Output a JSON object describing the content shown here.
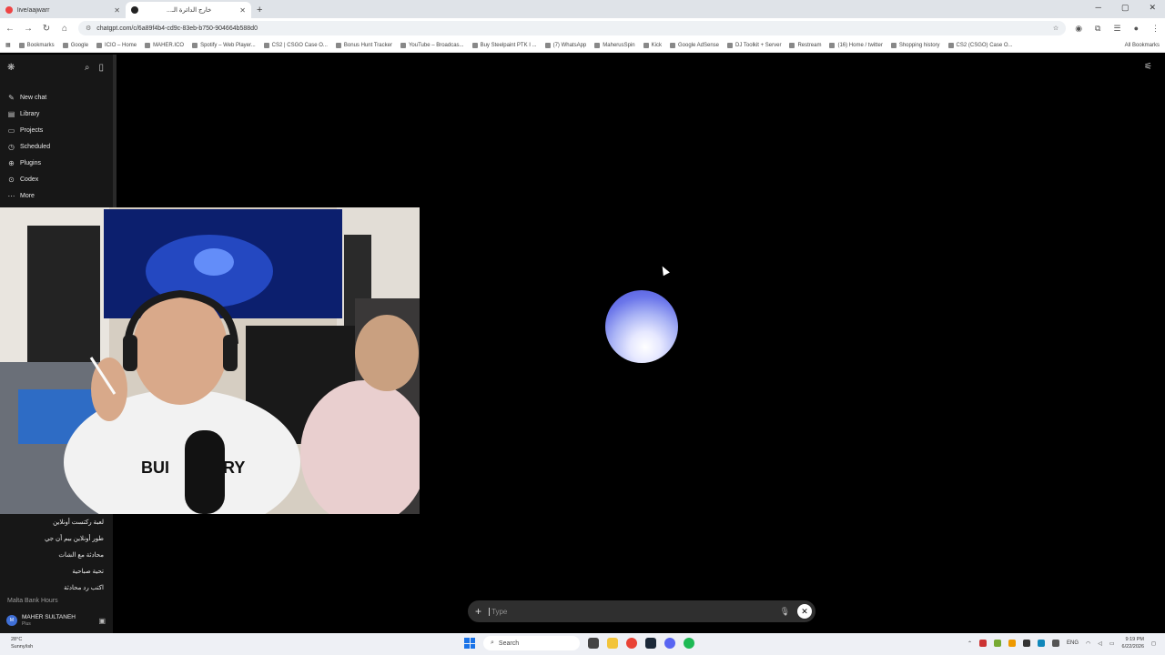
{
  "browser": {
    "tabs": [
      {
        "title": "live/aajwarr",
        "active": false
      },
      {
        "title": "...خارج الدائرة الـ",
        "active": true
      }
    ],
    "url": "chatgpt.com/c/6a89f4b4-cd9c-83eb-b750-904664b588d0",
    "bookmarks": [
      "Bookmarks",
      "Google",
      "ICIO – Home",
      "MAHER.ICO",
      "Spotify – Web Player...",
      "CS2 | CSGO Case O...",
      "Bonus Hunt Tracker",
      "YouTube – Broadcas...",
      "Buy Steelpaint PTK I ...",
      "(7) WhatsApp",
      "MaherusSpin",
      "Kick",
      "Google AdSense",
      "DJ Toolkit + Server",
      "Restream",
      "(16) Home / twitter",
      "Shopping history",
      "CS2 (CSGO) Case O..."
    ],
    "all_bookmarks": "All Bookmarks"
  },
  "sidebar": {
    "nav": [
      {
        "label": "New chat",
        "icon": "edit-icon"
      },
      {
        "label": "Library",
        "icon": "library-icon"
      },
      {
        "label": "Projects",
        "icon": "folder-icon"
      },
      {
        "label": "Scheduled",
        "icon": "clock-icon"
      },
      {
        "label": "Plugins",
        "icon": "plugin-icon"
      },
      {
        "label": "Codex",
        "icon": "codex-icon"
      },
      {
        "label": "More",
        "icon": "more-icon"
      }
    ],
    "chats": [
      "لعبة ركتست أونلاين",
      "طور أونلاين بيم أن جي",
      "محادثة مع الشات",
      "تحية صباحية",
      "اكتب رد محادثة"
    ],
    "faded_chat": "Malta Bank Hours",
    "user": {
      "initials": "M",
      "name": "MAHER SULTANEH",
      "plan": "Plus"
    }
  },
  "composer": {
    "placeholder": "Type"
  },
  "taskbar": {
    "weather_temp": "28°C",
    "weather_desc": "Sunny/ish",
    "search": "Search",
    "lang": "ENG",
    "time": "9:19 PM",
    "date": "6/22/2026"
  },
  "colors": {
    "orb_core": "#ffffff",
    "orb_edge": "#4a52d9",
    "sidebar_bg": "#171717",
    "composer_bg": "#2f2f2f"
  }
}
